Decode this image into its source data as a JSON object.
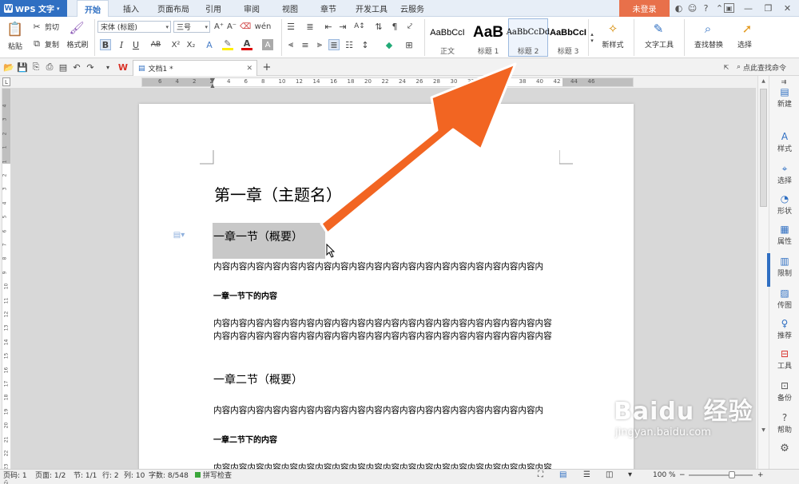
{
  "app": {
    "name": "WPS 文字",
    "login": "未登录"
  },
  "menu": [
    "开始",
    "插入",
    "页面布局",
    "引用",
    "审阅",
    "视图",
    "章节",
    "开发工具",
    "云服务"
  ],
  "ribbon": {
    "paste": "粘贴",
    "cut": "剪切",
    "copy": "复制",
    "format_painter": "格式刷",
    "font_name": "宋体 (标题)",
    "font_size": "三号",
    "styles": [
      {
        "sample": "AaBbCcI",
        "label": "正文"
      },
      {
        "sample": "AaB",
        "label": "标题 1"
      },
      {
        "sample": "AaBbCcDd",
        "label": "标题 2"
      },
      {
        "sample": "AaBbCcI",
        "label": "标题 3"
      }
    ],
    "new_style": "新样式",
    "text_tools": "文字工具",
    "find_replace": "查找替换",
    "select": "选择"
  },
  "tabs": {
    "doc_tab": "文档1 *",
    "search_cmd": "点此查找命令"
  },
  "ruler_numbers": [
    "6",
    "4",
    "2",
    "2",
    "4",
    "6",
    "8",
    "10",
    "12",
    "14",
    "16",
    "18",
    "20",
    "22",
    "24",
    "26",
    "28",
    "30",
    "32",
    "34",
    "36",
    "38",
    "40",
    "42",
    "44",
    "46"
  ],
  "vruler_numbers": [
    "4",
    "3",
    "2",
    "1",
    "1",
    "2",
    "3",
    "4",
    "5",
    "6",
    "7",
    "8",
    "9",
    "10",
    "11",
    "12",
    "13",
    "14",
    "15",
    "16",
    "17",
    "18",
    "19",
    "20",
    "21",
    "22",
    "23",
    "24"
  ],
  "document": {
    "chapter_title": "第一章（主题名）",
    "section1": "一章一节（概要）",
    "content_line": "内容内容内容内容内容内容内容内容内容内容内容内容内容内容内容内容内容内容内容内",
    "sub1": "一章一节下的内容",
    "content_line2a": "内容内容内容内容内容内容内容内容内容内容内容内容内容内容内容内容内容内容内容内容",
    "content_line2b": "内容内容内容内容内容内容内容内容内容内容内容内容内容内容内容内容内容内容内容内容",
    "section2": "一章二节（概要）",
    "content_line3": "内容内容内容内容内容内容内容内容内容内容内容内容内容内容内容内容内容内容内容内",
    "sub2": "一章二节下的内容",
    "content_line4": "内容内容内容内容内容内容内容内容内容内容内容内容内容内容内容内容内容内容内容内容"
  },
  "sidebar": [
    "新建",
    "样式",
    "选择",
    "形状",
    "属性",
    "限制",
    "传图",
    "推荐",
    "工具",
    "备份",
    "帮助"
  ],
  "status": {
    "page_code": "页码: 1",
    "page": "页面: 1/2",
    "section": "节: 1/1",
    "row": "行: 2",
    "col": "列: 10",
    "words": "字数: 8/548",
    "spell": "拼写检查",
    "zoom": "100 %"
  },
  "watermark": {
    "brand": "Baidu 经验",
    "url": "jingyan.baidu.com"
  },
  "colors": {
    "accent": "#2f6fc2",
    "login": "#e8704a",
    "arrow": "#f26522"
  }
}
